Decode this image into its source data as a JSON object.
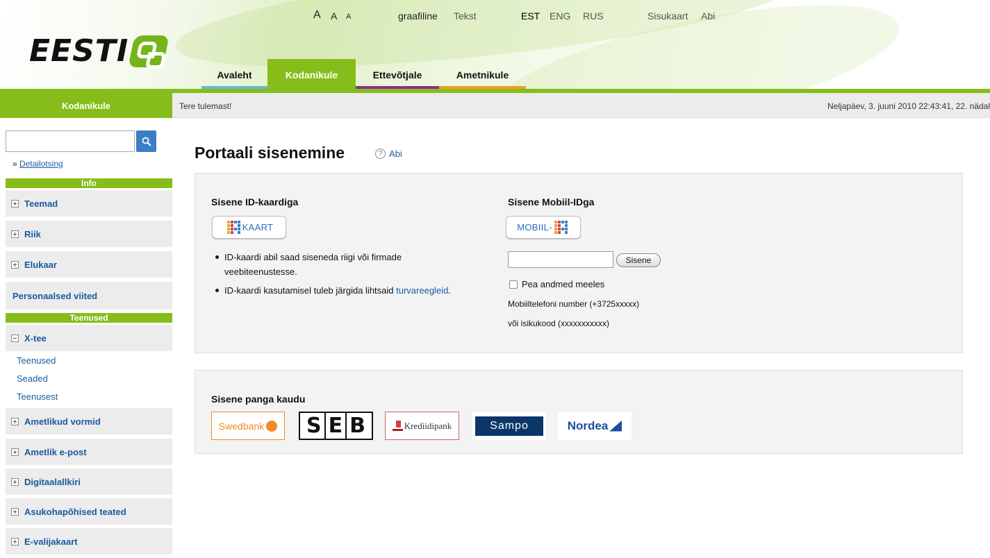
{
  "header": {
    "logo_text": "EESTI",
    "font_sizes": [
      "A",
      "A",
      "A"
    ],
    "view_modes": [
      "graafiline",
      "Tekst"
    ],
    "languages": [
      "EST",
      "ENG",
      "RUS"
    ],
    "links": [
      "Sisukaart",
      "Abi"
    ],
    "nav": [
      "Avaleht",
      "Kodanikule",
      "Ettevõtjale",
      "Ametnikule"
    ],
    "colors": {
      "green": "#86bd1a",
      "blue": "#68b8d8",
      "purple": "#8b2f8a",
      "orange": "#f0a020"
    }
  },
  "sidebar": {
    "title": "Kodanikule",
    "search_placeholder": "",
    "detail_prefix": "»",
    "detail_link": "Detailotsing",
    "section_info": "Info",
    "info_items": [
      "Teemad",
      "Riik",
      "Elukaar"
    ],
    "personal": "Personaalsed viited",
    "section_services": "Teenused",
    "xtee": "X-tee",
    "xtee_sub": [
      "Teenused",
      "Seaded",
      "Teenusest"
    ],
    "service_items": [
      "Ametlikud vormid",
      "Ametlik e-post",
      "Digitaalallkiri",
      "Asukohapõhised teated",
      "E-valijakaart"
    ]
  },
  "content": {
    "welcome": "Tere tulemast!",
    "datetime": "Neljapäev, 3. juuni 2010 22:43:41, 22. nädal",
    "title": "Portaali sisenemine",
    "help_icon": "?",
    "help": "Abi",
    "id_card": {
      "heading": "Sisene ID-kaardiga",
      "button_label": "KAART",
      "bullet1": "ID-kaardi abil saad siseneda riigi või firmade veebiteenustesse.",
      "bullet2_text": "ID-kaardi kasutamisel tuleb järgida lihtsaid",
      "bullet2_link": "turvareegleid",
      "bullet2_end": "."
    },
    "mobile_id": {
      "heading": "Sisene Mobiil-IDga",
      "button_label": "MOBIIL-",
      "input_value": "",
      "submit": "Sisene",
      "remember": "Pea andmed meeles",
      "note1": "Mobiiltelefoni number (+3725xxxxx)",
      "note2": "või isikukood (xxxxxxxxxxx)"
    },
    "bank": {
      "heading": "Sisene panga kaudu",
      "banks": [
        "Swedbank",
        "S",
        "E",
        "B",
        "Krediidipank",
        "Sampo",
        "Nordea"
      ]
    }
  }
}
